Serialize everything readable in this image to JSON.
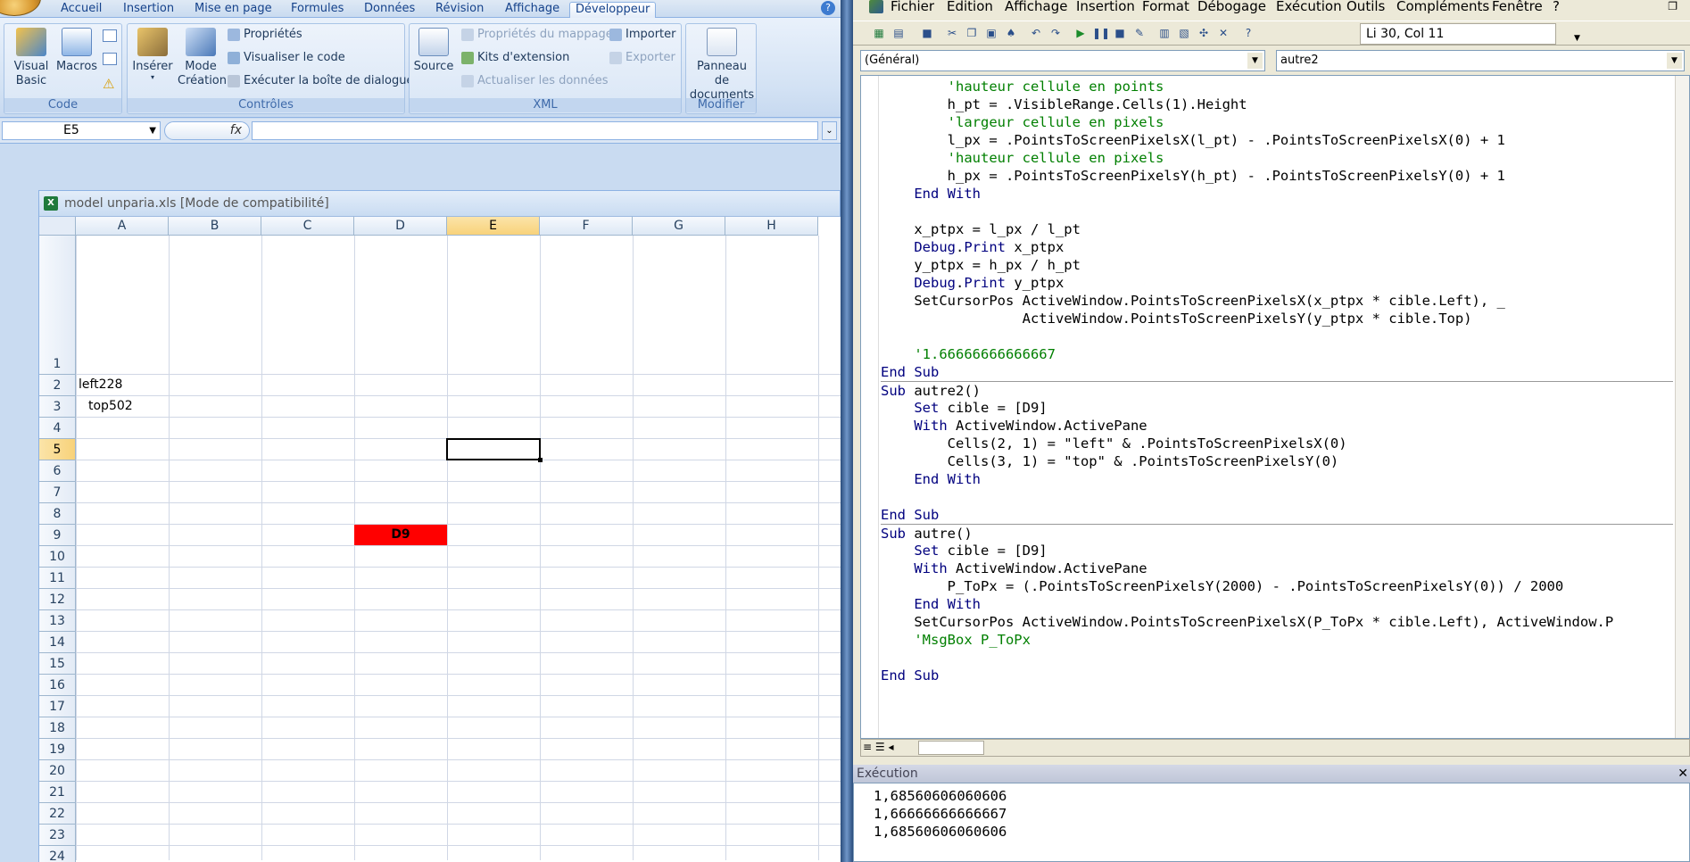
{
  "excel": {
    "tabs": [
      "Accueil",
      "Insertion",
      "Mise en page",
      "Formules",
      "Données",
      "Révision",
      "Affichage",
      "Développeur"
    ],
    "active_tab": "Développeur",
    "groups": {
      "code": {
        "label": "Code",
        "visual_basic": "Visual Basic",
        "macros": "Macros"
      },
      "controles": {
        "label": "Contrôles",
        "inserer": "Insérer",
        "mode_creation": "Mode Création",
        "proprietes": "Propriétés",
        "visualiser": "Visualiser le code",
        "executer": "Exécuter la boîte de dialogue"
      },
      "xml": {
        "label": "XML",
        "source": "Source",
        "proprietes_mappage": "Propriétés du mappage",
        "kits": "Kits d'extension",
        "actualiser": "Actualiser les données",
        "importer": "Importer",
        "exporter": "Exporter"
      },
      "modifier": {
        "label": "Modifier",
        "panneau": "Panneau de documents"
      }
    },
    "namebox": "E5",
    "fx": "fx",
    "workbook_title": "model unparia.xls  [Mode de compatibilité]",
    "columns": [
      "A",
      "B",
      "C",
      "D",
      "E",
      "F",
      "G",
      "H"
    ],
    "selected_column": "E",
    "rows": [
      "1",
      "2",
      "3",
      "4",
      "5",
      "6",
      "7",
      "8",
      "9",
      "10",
      "11",
      "12",
      "13",
      "14",
      "15",
      "16",
      "17",
      "18",
      "19",
      "20",
      "21",
      "22",
      "23",
      "24"
    ],
    "selected_row": "5",
    "cells": {
      "A2": "left228",
      "A3": "top502",
      "D9": "D9"
    },
    "d9_color": "#ff0000"
  },
  "vbe": {
    "menus": [
      "Fichier",
      "Edition",
      "Affichage",
      "Insertion",
      "Format",
      "Débogage",
      "Exécution",
      "Outils",
      "Compléments",
      "Fenêtre",
      "?"
    ],
    "position": "Li 30, Col 11",
    "object_combo": "(Général)",
    "proc_combo": "autre2",
    "code_lines": [
      "        'hauteur cellule en points",
      "        h_pt = .VisibleRange.Cells(1).Height",
      "        'largeur cellule en pixels",
      "        l_px = .PointsToScreenPixelsX(l_pt) - .PointsToScreenPixelsX(0) + 1",
      "        'hauteur cellule en pixels",
      "        h_px = .PointsToScreenPixelsY(h_pt) - .PointsToScreenPixelsY(0) + 1",
      "    End With",
      "",
      "    x_ptpx = l_px / l_pt",
      "    Debug.Print x_ptpx",
      "    y_ptpx = h_px / h_pt",
      "    Debug.Print y_ptpx",
      "    SetCursorPos ActiveWindow.PointsToScreenPixelsX(x_ptpx * cible.Left), _",
      "                 ActiveWindow.PointsToScreenPixelsY(y_ptpx * cible.Top)",
      "",
      "    '1.66666666666667",
      "End Sub",
      "Sub autre2()",
      "    Set cible = [D9]",
      "    With ActiveWindow.ActivePane",
      "        Cells(2, 1) = \"left\" & .PointsToScreenPixelsX(0)",
      "        Cells(3, 1) = \"top\" & .PointsToScreenPixelsY(0)",
      "    End With",
      "",
      "End Sub",
      "Sub autre()",
      "    Set cible = [D9]",
      "    With ActiveWindow.ActivePane",
      "        P_ToPx = (.PointsToScreenPixelsY(2000) - .PointsToScreenPixelsY(0)) / 2000",
      "    End With",
      "    SetCursorPos ActiveWindow.PointsToScreenPixelsX(P_ToPx * cible.Left), ActiveWindow.P",
      "    'MsgBox P_ToPx",
      "",
      "End Sub"
    ],
    "immediate_title": "Exécution",
    "immediate_lines": [
      "1,68560606060606",
      "1,66666666666667",
      "1,68560606060606"
    ]
  }
}
